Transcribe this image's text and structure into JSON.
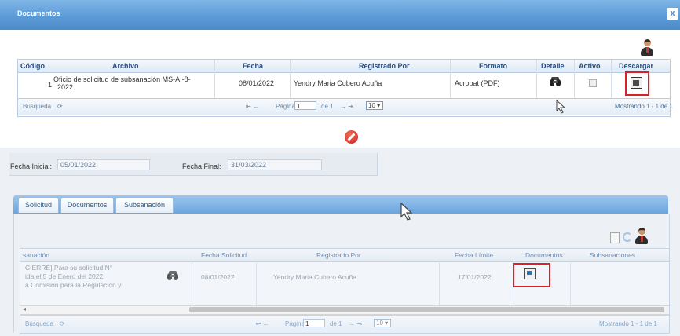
{
  "modal": {
    "title": "Documentos",
    "close_label": "x"
  },
  "documents_grid": {
    "columns": [
      "Código",
      "Archivo",
      "Fecha",
      "Registrado Por",
      "Formato",
      "Detalle",
      "Activo",
      "Descargar"
    ],
    "rows": [
      {
        "codigo": "1",
        "archivo_line1": "Oficio de solicitud de subsanación MS-AI-8-",
        "archivo_line2": "2022.",
        "fecha": "08/01/2022",
        "registrado_por": "Yendry Maria Cubero Acuña",
        "formato": "Acrobat (PDF)"
      }
    ],
    "pager": {
      "search_label": "Búsqueda",
      "page_label": "Página",
      "page_value": "1",
      "of_label": "de 1",
      "page_size": "10",
      "showing": "Mostrando 1 - 1 de 1"
    }
  },
  "form": {
    "fecha_inicial_label": "Fecha Inicial:",
    "fecha_inicial_value": "05/01/2022",
    "fecha_final_label": "Fecha Final:",
    "fecha_final_value": "31/03/2022"
  },
  "tabs": [
    {
      "label": "Solicitud"
    },
    {
      "label": "Documentos"
    },
    {
      "label": "Subsanación"
    }
  ],
  "requests_grid": {
    "columns": [
      "sanación",
      "Fecha Solicitud",
      "Registrado Por",
      "Fecha Límite",
      "Documentos",
      "Subsanaciones"
    ],
    "rows": [
      {
        "desc_line1": "CIERRE] Para su solicitud N°",
        "desc_line2": "ida el 5 de Enero del 2022,",
        "desc_line3": "a Comisión para la Regulación y",
        "fecha_solicitud": "08/01/2022",
        "registrado_por": "Yendry Maria Cubero Acuña",
        "fecha_limite": "17/01/2022"
      }
    ],
    "pager": {
      "search_label": "Búsqueda",
      "page_label": "Página",
      "page_value": "1",
      "of_label": "de 1",
      "page_size": "10",
      "showing": "Mostrando 1 - 1 de 1"
    }
  },
  "icons": [
    "user-icon",
    "binoculars-icon",
    "download-icon",
    "cancel-icon",
    "page-icon",
    "refresh-icon",
    "cursor-icon"
  ],
  "colors": {
    "header_blue": "#5a98d6",
    "highlight_red": "#d6202a",
    "grid_header_text": "#2a4e7a"
  }
}
